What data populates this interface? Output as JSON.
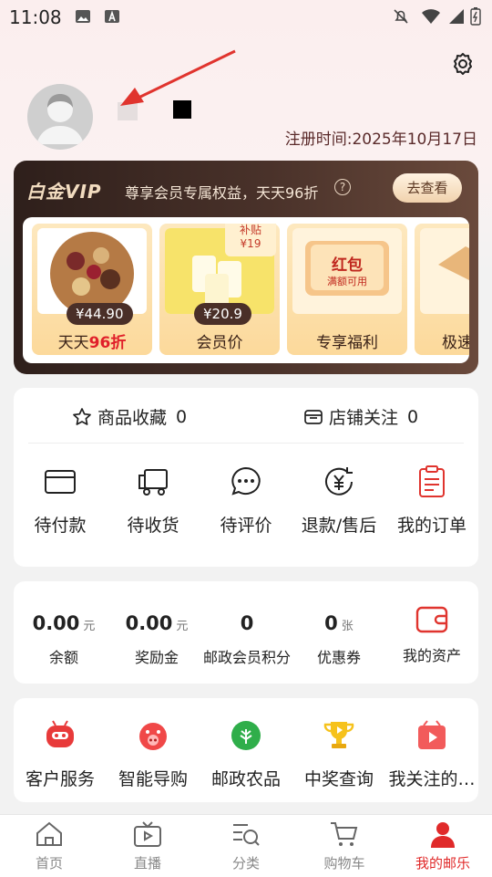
{
  "status_bar": {
    "time": "11:08"
  },
  "header": {
    "reg_time": "注册时间:2025年10月17日"
  },
  "vip": {
    "logo": "白金VIP",
    "text": "尊享会员专属权益，天天96折",
    "question": "?",
    "button": "去查看",
    "products": [
      {
        "price": "¥44.90",
        "label_prefix": "天天",
        "label_red": "96折"
      },
      {
        "price": "¥20.9",
        "label_prefix": "会员价",
        "label_red": "",
        "tag_line1": "补贴",
        "tag_line2": "¥19"
      },
      {
        "label_prefix": "专享福利",
        "label_red": "",
        "coupon_title": "红包",
        "coupon_sub": "满额可用"
      },
      {
        "label_prefix": "极速",
        "label_red": ""
      }
    ]
  },
  "orders": {
    "fav_label": "商品收藏",
    "fav_count": "0",
    "follow_label": "店铺关注",
    "follow_count": "0",
    "items": [
      {
        "label": "待付款",
        "icon": "card-icon"
      },
      {
        "label": "待收货",
        "icon": "truck-icon"
      },
      {
        "label": "待评价",
        "icon": "chat-icon"
      },
      {
        "label": "退款/售后",
        "icon": "refund-icon"
      },
      {
        "label": "我的订单",
        "icon": "order-list-icon"
      }
    ]
  },
  "assets": {
    "items": [
      {
        "value": "0.00",
        "unit": "元",
        "label": "余额"
      },
      {
        "value": "0.00",
        "unit": "元",
        "label": "奖励金"
      },
      {
        "value": "0",
        "unit": "",
        "label": "邮政会员积分"
      },
      {
        "value": "0",
        "unit": "张",
        "label": "优惠券"
      }
    ],
    "my_assets": "我的资产"
  },
  "services": {
    "items": [
      {
        "label": "客户服务",
        "icon": "customer-service-icon"
      },
      {
        "label": "智能导购",
        "icon": "smart-guide-icon"
      },
      {
        "label": "邮政农品",
        "icon": "agri-icon"
      },
      {
        "label": "中奖查询",
        "icon": "trophy-icon"
      },
      {
        "label": "我关注的…",
        "icon": "video-icon"
      }
    ]
  },
  "nav": {
    "items": [
      {
        "label": "首页",
        "icon": "home-icon"
      },
      {
        "label": "直播",
        "icon": "tv-icon"
      },
      {
        "label": "分类",
        "icon": "category-icon"
      },
      {
        "label": "购物车",
        "icon": "cart-icon"
      },
      {
        "label": "我的邮乐",
        "icon": "profile-icon"
      }
    ]
  },
  "colors": {
    "accent": "#e02a2a",
    "vip_bg": "#2e1f1b",
    "gold": "#fcd99b"
  }
}
